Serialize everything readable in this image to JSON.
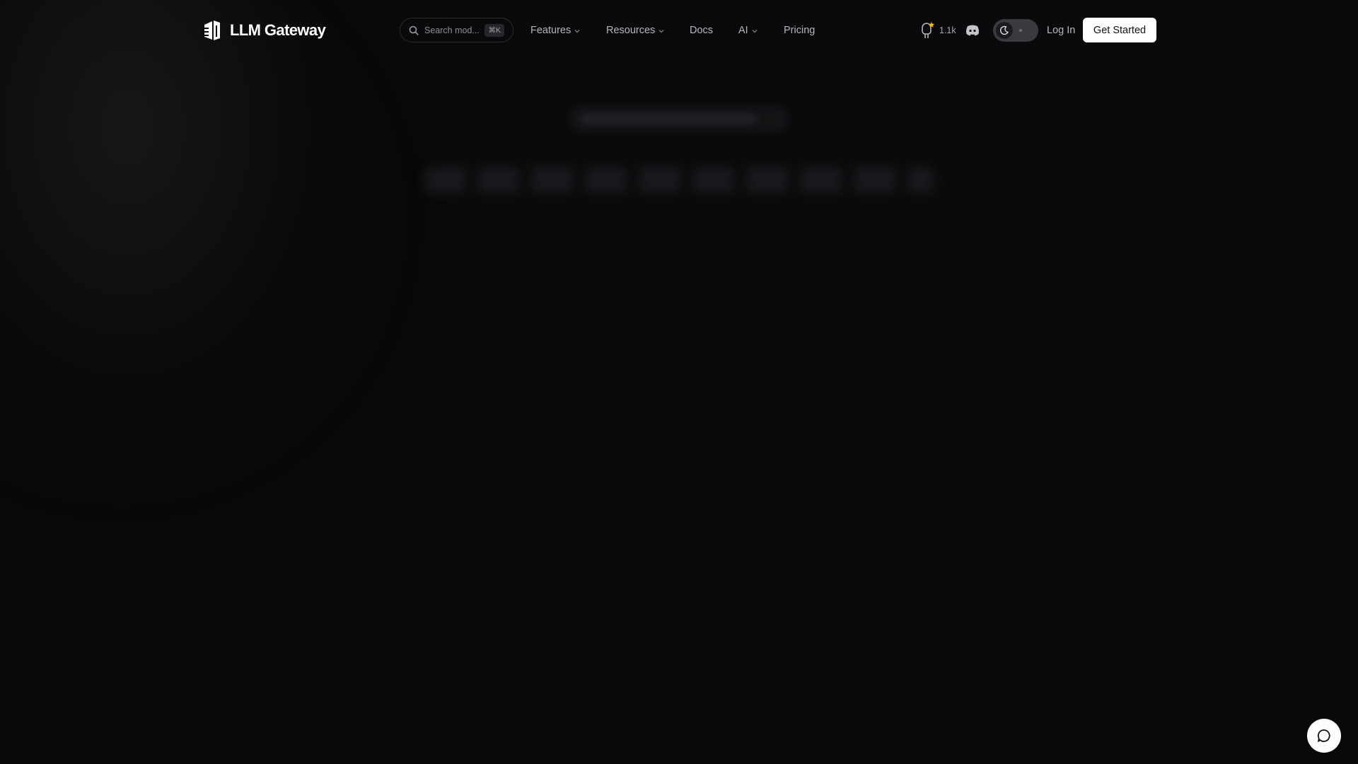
{
  "brand": {
    "name": "LLM Gateway"
  },
  "search": {
    "placeholder": "Search mod...",
    "shortcut": "⌘K"
  },
  "nav": {
    "features": "Features",
    "resources": "Resources",
    "docs": "Docs",
    "ai": "AI",
    "pricing": "Pricing"
  },
  "actions": {
    "github_stars": "1.1k",
    "login": "Log In",
    "get_started": "Get Started"
  },
  "theme": {
    "mode": "dark"
  },
  "icons": {
    "logo": "llm-gateway-logo",
    "search": "search-icon",
    "chevron": "chevron-down-icon",
    "github": "github-icon",
    "star": "star-icon",
    "discord": "discord-icon",
    "moon": "moon-icon",
    "sun": "sun-icon",
    "chat": "chat-bubble-icon"
  },
  "colors": {
    "background": "#0a0a0c",
    "cta_bg": "#ffffff",
    "star": "#f5b700"
  }
}
